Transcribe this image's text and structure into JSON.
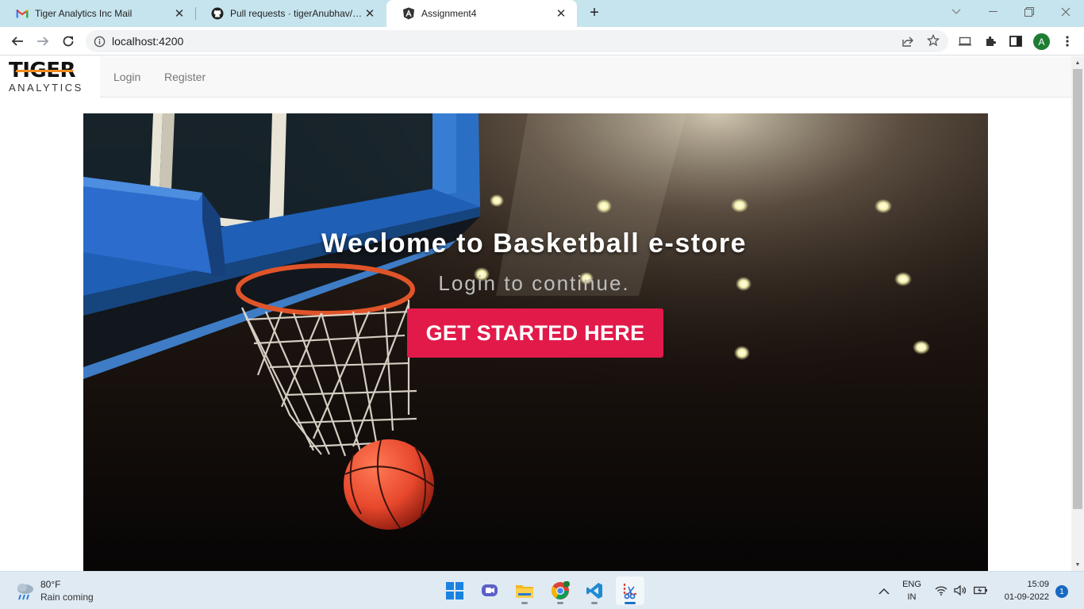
{
  "browser": {
    "tabs": [
      {
        "title": "Tiger Analytics Inc Mail",
        "icon": "gmail-icon"
      },
      {
        "title": "Pull requests · tigerAnubhav/reta",
        "icon": "github-icon"
      },
      {
        "title": "Assignment4",
        "icon": "angular-icon",
        "active": true
      }
    ],
    "url": "localhost:4200",
    "profile_initial": "A"
  },
  "page": {
    "brand": {
      "line1": "TIGER",
      "line2": "ANALYTICS"
    },
    "nav": {
      "login": "Login",
      "register": "Register"
    },
    "hero": {
      "title": "Weclome to Basketball e-store",
      "subtitle": "Login to continue.",
      "cta": "GET STARTED HERE",
      "cta_color": "#e21a4a"
    }
  },
  "taskbar": {
    "weather": {
      "temp": "80°F",
      "condition": "Rain coming"
    },
    "apps": [
      "windows-start-icon",
      "teams-chat-icon",
      "file-explorer-icon",
      "chrome-icon",
      "vscode-icon",
      "snipping-tool-icon"
    ],
    "language": {
      "line1": "ENG",
      "line2": "IN"
    },
    "clock": {
      "time": "15:09",
      "date": "01-09-2022"
    },
    "notifications": "1"
  }
}
